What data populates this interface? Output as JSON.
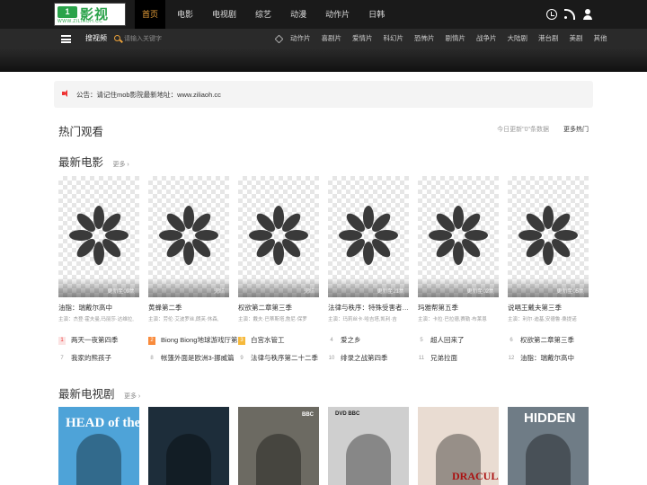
{
  "header": {
    "logo_mark": "1",
    "logo_text": "影视",
    "logo_sub": "WWW.ZILIAOH.CC",
    "nav": [
      {
        "label": "首页",
        "active": true
      },
      {
        "label": "电影",
        "active": false
      },
      {
        "label": "电视剧",
        "active": false
      },
      {
        "label": "综艺",
        "active": false
      },
      {
        "label": "动漫",
        "active": false
      },
      {
        "label": "动作片",
        "active": false
      },
      {
        "label": "日韩",
        "active": false
      }
    ],
    "icons": [
      "clock-icon",
      "rss-icon",
      "user-icon"
    ]
  },
  "subnav": {
    "label": "搜视频",
    "search_placeholder": "请输入关键字",
    "genres": [
      "动作片",
      "喜剧片",
      "爱情片",
      "科幻片",
      "恐怖片",
      "剧情片",
      "战争片",
      "大陆剧",
      "港台剧",
      "美剧",
      "其他"
    ]
  },
  "notice": {
    "text": "公告：请记住mob影院最新地址：www.ziliaoh.cc"
  },
  "hot": {
    "title": "热门观看",
    "update_note": "今日更新\"0\"条数据",
    "more_label": "更多热门"
  },
  "movies": {
    "title": "最新电影",
    "more": "更多 ›",
    "items": [
      {
        "title": "油脂：瑞戴尔高中",
        "cast": "主演：杰登·霍夫曼,玛丽莎·达维拉,",
        "note": "更新至09集"
      },
      {
        "title": "黄蜂第二季",
        "cast": "主演：劳伦·艾波罗丝,朗芙·休森,",
        "note": "完结"
      },
      {
        "title": "权欲第二章第三季",
        "cast": "主演：戴夫·巴蒂斯塔,詹尼·保罗",
        "note": "完结"
      },
      {
        "title": "法律与秩序：特殊受害者第二十四季",
        "cast": "主演：玛莉丝卡·哈吉塔,凯利·吉",
        "note": "更新至21集"
      },
      {
        "title": "玛雅帮第五季",
        "cast": "主演：卡拉·巴拉德,赛勒·布莱恩",
        "note": "更新至02集"
      },
      {
        "title": "说唱王戴夫第三季",
        "cast": "主演：利尔·迪基,安德鲁·桑提诺",
        "note": "更新至05集"
      }
    ]
  },
  "rank": [
    {
      "num": "1",
      "title": "两天一夜第四季"
    },
    {
      "num": "2",
      "title": "Biong Biong地球游戏厅第二季"
    },
    {
      "num": "3",
      "title": "白宫水管工"
    },
    {
      "num": "4",
      "title": "爱之乡"
    },
    {
      "num": "5",
      "title": "超人回来了"
    },
    {
      "num": "6",
      "title": "权欲第二章第三季"
    },
    {
      "num": "7",
      "title": "我家的熊孩子"
    },
    {
      "num": "8",
      "title": "帐篷外面是欧洲3-挪威篇"
    },
    {
      "num": "9",
      "title": "法律与秩序第二十二季"
    },
    {
      "num": "10",
      "title": "绯录之战第四季"
    },
    {
      "num": "11",
      "title": "兄弟拉面"
    },
    {
      "num": "12",
      "title": "油脂：瑞戴尔高中"
    }
  ],
  "tv": {
    "title": "最新电视剧",
    "more": "更多 ›",
    "posters": [
      {
        "text": "HEAD of the CLASS",
        "bg": "#4ea3d8"
      },
      {
        "text": "",
        "bg": "#1d2d3a"
      },
      {
        "text": "BBC",
        "bg": "#6c6a62"
      },
      {
        "text": "DVD BBC",
        "bg": "#cfcfcf"
      },
      {
        "text": "DRACULA",
        "bg": "#e9dcd2"
      },
      {
        "text": "HIDDEN",
        "bg": "#6f7c86"
      }
    ]
  },
  "colors": {
    "accent": "#e8a03a",
    "brand_green": "#2aa34a",
    "topbar": "#1a1a1a",
    "alert_red": "#e33"
  }
}
